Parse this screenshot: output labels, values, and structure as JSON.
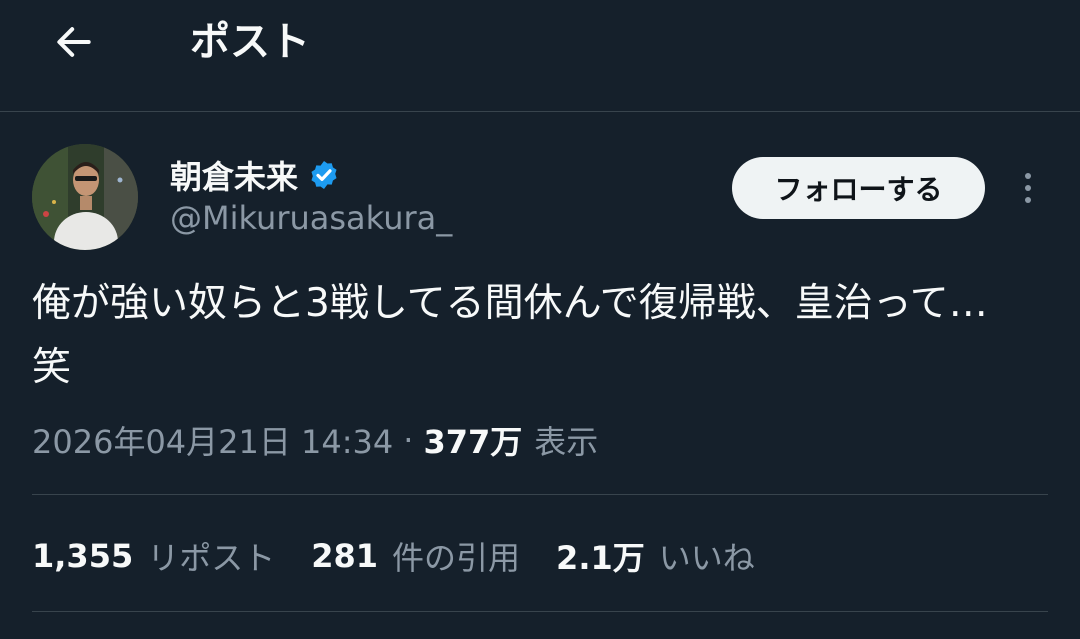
{
  "header": {
    "title": "ポスト",
    "back_icon": "arrow-left-icon"
  },
  "author": {
    "display_name": "朝倉未来",
    "handle": "@Mikuruasakura_",
    "verified": true,
    "verified_color": "#1d9bf0",
    "follow_label": "フォローする",
    "more_icon": "more-vertical-icon"
  },
  "post": {
    "lines": [
      "俺が強い奴らと3戦してる間休んで復帰戦、皇治って…",
      "笑"
    ],
    "timestamp": "2026年04月21日 14:34",
    "separator": "·",
    "views_count": "377万",
    "views_label": "表示"
  },
  "stats": {
    "reposts": {
      "count": "1,355",
      "label": "リポスト"
    },
    "quotes": {
      "count": "281",
      "label": "件の引用"
    },
    "likes": {
      "count": "2.1万",
      "label": "いいね"
    }
  },
  "colors": {
    "background": "#15202b",
    "border": "#38444d",
    "text_primary": "#f7f9f9",
    "text_secondary": "#8b98a5",
    "button_bg": "#eff3f4"
  }
}
